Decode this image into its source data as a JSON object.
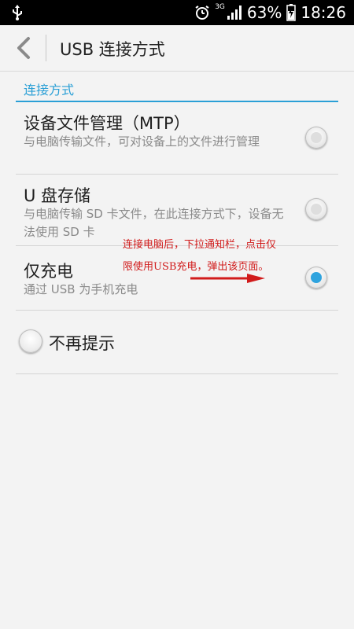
{
  "status_bar": {
    "network": "3G",
    "battery": "63%",
    "time": "18:26"
  },
  "header": {
    "title": "USB 连接方式"
  },
  "section": {
    "title": "连接方式"
  },
  "options": [
    {
      "title": "设备文件管理（MTP）",
      "subtitle": "与电脑传输文件，可对设备上的文件进行管理",
      "selected": false
    },
    {
      "title": "U 盘存储",
      "subtitle": "与电脑传输 SD 卡文件，在此连接方式下，设备无法使用 SD 卡",
      "selected": false
    },
    {
      "title": "仅充电",
      "subtitle": "通过 USB 为手机充电",
      "selected": true
    }
  ],
  "annotation": {
    "line1": "连接电脑后，下拉通知栏，点击仅",
    "line2": "限使用USB充电，弹出该页面。",
    "color": "#d11b1b"
  },
  "dont_remind": {
    "label": "不再提示",
    "checked": false
  },
  "colors": {
    "accent": "#2a9fd6"
  }
}
